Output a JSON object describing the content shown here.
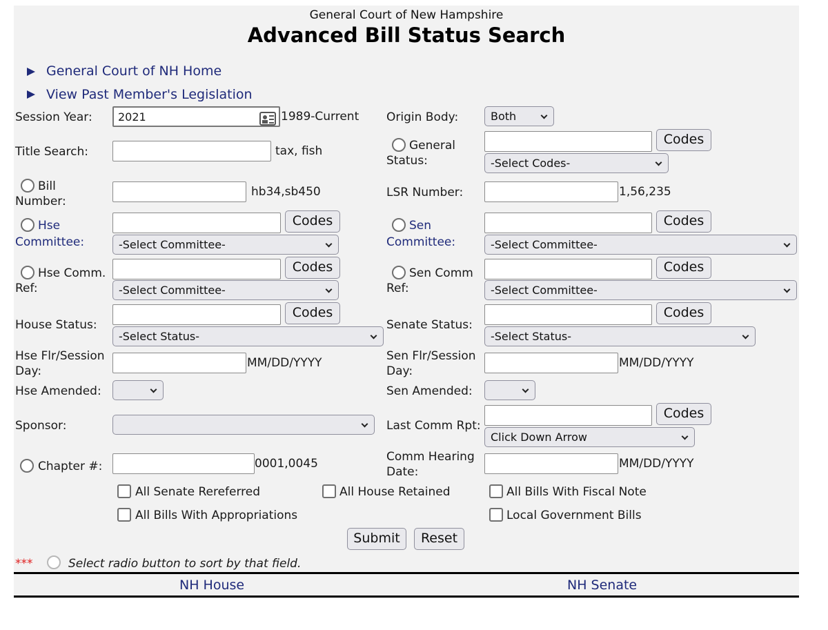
{
  "header": {
    "site_name": "General Court of New Hampshire",
    "title": "Advanced Bill Status Search"
  },
  "nav": {
    "home": "General Court of NH Home",
    "past_member": "View Past Member's Legislation"
  },
  "fields": {
    "session_year": {
      "label": "Session Year:",
      "value": "2021",
      "hint": "1989-Current"
    },
    "origin_body": {
      "label": "Origin Body:",
      "value": "Both"
    },
    "title_search": {
      "label": "Title Search:",
      "value": "",
      "hint": "tax, fish"
    },
    "general_status": {
      "label_1": "General",
      "label_2": "Status:",
      "select": "-Select Codes-"
    },
    "bill_number": {
      "label_1": "Bill",
      "label_2": "Number:",
      "value": "",
      "hint": "hb34,sb450"
    },
    "lsr_number": {
      "label": "LSR Number:",
      "value": "",
      "hint": "1,56,235"
    },
    "hse_committee": {
      "label_1": "Hse",
      "label_2": "Committee:",
      "select": "-Select Committee-"
    },
    "sen_committee": {
      "label_1": "Sen",
      "label_2": "Committee:",
      "select": "-Select Committee-"
    },
    "hse_comm_ref": {
      "label_1": "Hse Comm.",
      "label_2": "Ref:",
      "select": "-Select Committee-"
    },
    "sen_comm_ref": {
      "label_1": "Sen Comm",
      "label_2": "Ref:",
      "select": "-Select Committee-"
    },
    "house_status": {
      "label": "House Status:",
      "select": "-Select Status-"
    },
    "senate_status": {
      "label": "Senate Status:",
      "select": "-Select Status-"
    },
    "hse_flr": {
      "label_1": "Hse Flr/Session",
      "label_2": "Day:",
      "hint": "MM/DD/YYYY"
    },
    "sen_flr": {
      "label_1": "Sen Flr/Session",
      "label_2": "Day:",
      "hint": "MM/DD/YYYY"
    },
    "hse_amended": {
      "label": "Hse Amended:",
      "value": ""
    },
    "sen_amended": {
      "label": "Sen Amended:",
      "value": ""
    },
    "sponsor": {
      "label": "Sponsor:",
      "value": ""
    },
    "last_comm_rpt": {
      "label": "Last Comm Rpt:",
      "select": "Click Down Arrow"
    },
    "chapter": {
      "label": "Chapter #:",
      "hint": "0001,0045"
    },
    "comm_hearing": {
      "label_1": "Comm Hearing",
      "label_2": "Date:",
      "hint": "MM/DD/YYYY"
    }
  },
  "codes_label": "Codes",
  "checkboxes": {
    "senate_rereferred": "All Senate Rereferred",
    "house_retained": "All House Retained",
    "fiscal_note": "All Bills With Fiscal Note",
    "appropriations": "All Bills With Appropriations",
    "local_gov": "Local Government Bills"
  },
  "buttons": {
    "submit": "Submit",
    "reset": "Reset"
  },
  "note": {
    "stars": "***",
    "text": "Select radio button to sort by that field."
  },
  "footer": {
    "house": "NH House",
    "senate": "NH Senate"
  },
  "colors": {
    "link": "#1f2a7a",
    "panel": "#f2f2f2",
    "star": "#e02020"
  }
}
